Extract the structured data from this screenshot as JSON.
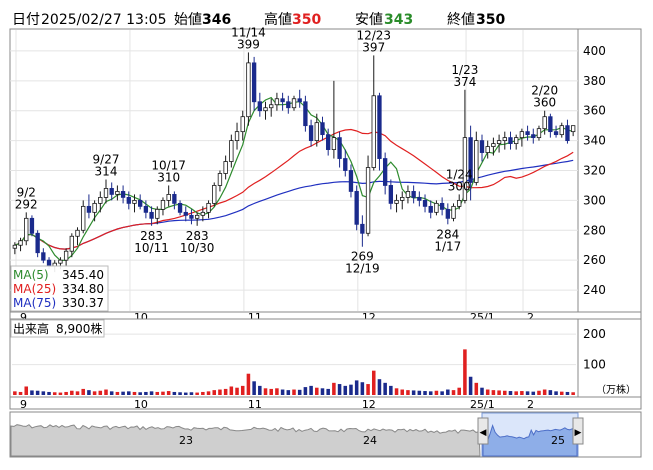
{
  "header": {
    "date_label": "日付",
    "datetime": "2025/02/27 13:05",
    "open_label": "始値",
    "open": "346",
    "high_label": "高値",
    "high": "350",
    "low_label": "安値",
    "low": "343",
    "close_label": "終値",
    "close": "350"
  },
  "colors": {
    "up": "#1a1a1a",
    "down": "#1a2a8c",
    "ma5": "#2e8b2e",
    "ma25": "#e02020",
    "ma75": "#2030c0",
    "volume_up": "#e02020",
    "volume_down": "#1a2a8c",
    "navigator_fill": "#8eaee8"
  },
  "legend": [
    {
      "label": "MA(5)",
      "value": "345.40",
      "color": "#2e8b2e"
    },
    {
      "label": "MA(25)",
      "value": "334.80",
      "color": "#e02020"
    },
    {
      "label": "MA(75)",
      "value": "330.37",
      "color": "#2030c0"
    }
  ],
  "volume_panel": {
    "label": "出来高",
    "value": "8,900株",
    "unit": "（万株）"
  },
  "month_labels": [
    "9",
    "10",
    "11",
    "12",
    "25/1",
    "2"
  ],
  "navigator_labels": [
    "23",
    "24",
    "25"
  ],
  "chart_data": {
    "type": "candlestick",
    "y_ticks": [
      240,
      260,
      280,
      300,
      320,
      340,
      360,
      380,
      400
    ],
    "ylim": [
      226,
      414
    ],
    "volume_ticks": [
      100,
      200
    ],
    "volume_ylim": [
      0,
      240
    ],
    "annotations": [
      {
        "date": "9/2",
        "price": "292"
      },
      {
        "date": "9/27",
        "price": "314"
      },
      {
        "date": "10/11",
        "price": "283"
      },
      {
        "date": "10/17",
        "price": "310"
      },
      {
        "date": "10/30",
        "price": "283"
      },
      {
        "date": "11/14",
        "price": "399"
      },
      {
        "date": "12/23",
        "price": "397"
      },
      {
        "date": "12/19",
        "price": "269"
      },
      {
        "date": "1/23",
        "price": "374"
      },
      {
        "date": "1/17",
        "price": "284"
      },
      {
        "date": "1/24",
        "price": "300"
      },
      {
        "date": "2/20",
        "price": "360"
      }
    ],
    "candles": [
      [
        268,
        272,
        264,
        270,
        12
      ],
      [
        270,
        275,
        266,
        273,
        10
      ],
      [
        273,
        292,
        270,
        288,
        28
      ],
      [
        288,
        290,
        276,
        278,
        15
      ],
      [
        278,
        280,
        262,
        265,
        14
      ],
      [
        265,
        268,
        258,
        260,
        12
      ],
      [
        260,
        262,
        254,
        256,
        10
      ],
      [
        256,
        260,
        252,
        258,
        9
      ],
      [
        258,
        262,
        254,
        260,
        8
      ],
      [
        260,
        268,
        256,
        266,
        10
      ],
      [
        266,
        278,
        262,
        276,
        14
      ],
      [
        276,
        282,
        270,
        280,
        12
      ],
      [
        280,
        300,
        278,
        296,
        20
      ],
      [
        296,
        304,
        288,
        292,
        16
      ],
      [
        292,
        300,
        286,
        298,
        12
      ],
      [
        298,
        306,
        292,
        302,
        14
      ],
      [
        302,
        314,
        298,
        308,
        18
      ],
      [
        308,
        312,
        300,
        304,
        12
      ],
      [
        304,
        310,
        300,
        306,
        10
      ],
      [
        306,
        310,
        298,
        302,
        11
      ],
      [
        302,
        306,
        294,
        298,
        12
      ],
      [
        298,
        304,
        292,
        300,
        10
      ],
      [
        300,
        304,
        294,
        296,
        9
      ],
      [
        296,
        300,
        288,
        292,
        10
      ],
      [
        292,
        296,
        283,
        288,
        12
      ],
      [
        288,
        296,
        284,
        294,
        10
      ],
      [
        294,
        302,
        290,
        300,
        11
      ],
      [
        300,
        310,
        296,
        304,
        13
      ],
      [
        304,
        306,
        294,
        298,
        10
      ],
      [
        298,
        300,
        290,
        292,
        9
      ],
      [
        292,
        296,
        286,
        290,
        8
      ],
      [
        290,
        294,
        284,
        288,
        9
      ],
      [
        288,
        292,
        283,
        290,
        8
      ],
      [
        290,
        296,
        286,
        292,
        10
      ],
      [
        292,
        300,
        288,
        298,
        12
      ],
      [
        298,
        312,
        296,
        310,
        16
      ],
      [
        310,
        320,
        306,
        318,
        18
      ],
      [
        318,
        330,
        314,
        326,
        20
      ],
      [
        326,
        344,
        322,
        340,
        28
      ],
      [
        340,
        352,
        334,
        346,
        24
      ],
      [
        346,
        360,
        340,
        356,
        30
      ],
      [
        356,
        399,
        350,
        392,
        70
      ],
      [
        392,
        396,
        360,
        366,
        45
      ],
      [
        366,
        372,
        356,
        360,
        30
      ],
      [
        360,
        366,
        354,
        362,
        22
      ],
      [
        362,
        368,
        356,
        364,
        20
      ],
      [
        364,
        372,
        360,
        368,
        22
      ],
      [
        368,
        372,
        360,
        366,
        18
      ],
      [
        366,
        370,
        358,
        362,
        16
      ],
      [
        362,
        370,
        360,
        368,
        18
      ],
      [
        368,
        374,
        362,
        366,
        17
      ],
      [
        366,
        370,
        346,
        350,
        26
      ],
      [
        350,
        354,
        336,
        340,
        30
      ],
      [
        340,
        358,
        336,
        352,
        24
      ],
      [
        352,
        356,
        340,
        344,
        22
      ],
      [
        344,
        348,
        330,
        334,
        20
      ],
      [
        334,
        380,
        328,
        342,
        40
      ],
      [
        342,
        346,
        322,
        328,
        36
      ],
      [
        328,
        334,
        316,
        320,
        30
      ],
      [
        320,
        324,
        302,
        306,
        34
      ],
      [
        306,
        310,
        280,
        284,
        48
      ],
      [
        284,
        290,
        269,
        278,
        42
      ],
      [
        278,
        330,
        276,
        322,
        36
      ],
      [
        322,
        397,
        320,
        370,
        80
      ],
      [
        370,
        372,
        320,
        328,
        52
      ],
      [
        328,
        332,
        304,
        310,
        40
      ],
      [
        310,
        314,
        294,
        298,
        30
      ],
      [
        298,
        304,
        292,
        300,
        22
      ],
      [
        300,
        306,
        294,
        302,
        18
      ],
      [
        302,
        310,
        298,
        306,
        16
      ],
      [
        306,
        310,
        298,
        302,
        15
      ],
      [
        302,
        306,
        296,
        300,
        14
      ],
      [
        300,
        304,
        292,
        296,
        13
      ],
      [
        296,
        300,
        288,
        292,
        12
      ],
      [
        292,
        300,
        290,
        298,
        14
      ],
      [
        298,
        302,
        290,
        294,
        12
      ],
      [
        294,
        298,
        284,
        288,
        18
      ],
      [
        288,
        298,
        286,
        296,
        16
      ],
      [
        296,
        304,
        294,
        300,
        24
      ],
      [
        300,
        374,
        298,
        342,
        150
      ],
      [
        342,
        350,
        300,
        312,
        60
      ],
      [
        312,
        346,
        310,
        340,
        40
      ],
      [
        340,
        344,
        326,
        332,
        24
      ],
      [
        332,
        340,
        328,
        336,
        18
      ],
      [
        336,
        342,
        330,
        338,
        16
      ],
      [
        338,
        344,
        332,
        340,
        15
      ],
      [
        340,
        346,
        334,
        342,
        14
      ],
      [
        342,
        346,
        334,
        338,
        13
      ],
      [
        338,
        344,
        334,
        342,
        12
      ],
      [
        342,
        348,
        336,
        346,
        13
      ],
      [
        346,
        350,
        340,
        344,
        12
      ],
      [
        344,
        348,
        338,
        342,
        11
      ],
      [
        342,
        350,
        340,
        348,
        14
      ],
      [
        348,
        360,
        344,
        356,
        18
      ],
      [
        356,
        358,
        342,
        346,
        16
      ],
      [
        346,
        350,
        342,
        344,
        12
      ],
      [
        344,
        352,
        342,
        350,
        11
      ],
      [
        350,
        354,
        338,
        340,
        10
      ],
      [
        346,
        350,
        343,
        350,
        9
      ]
    ]
  }
}
